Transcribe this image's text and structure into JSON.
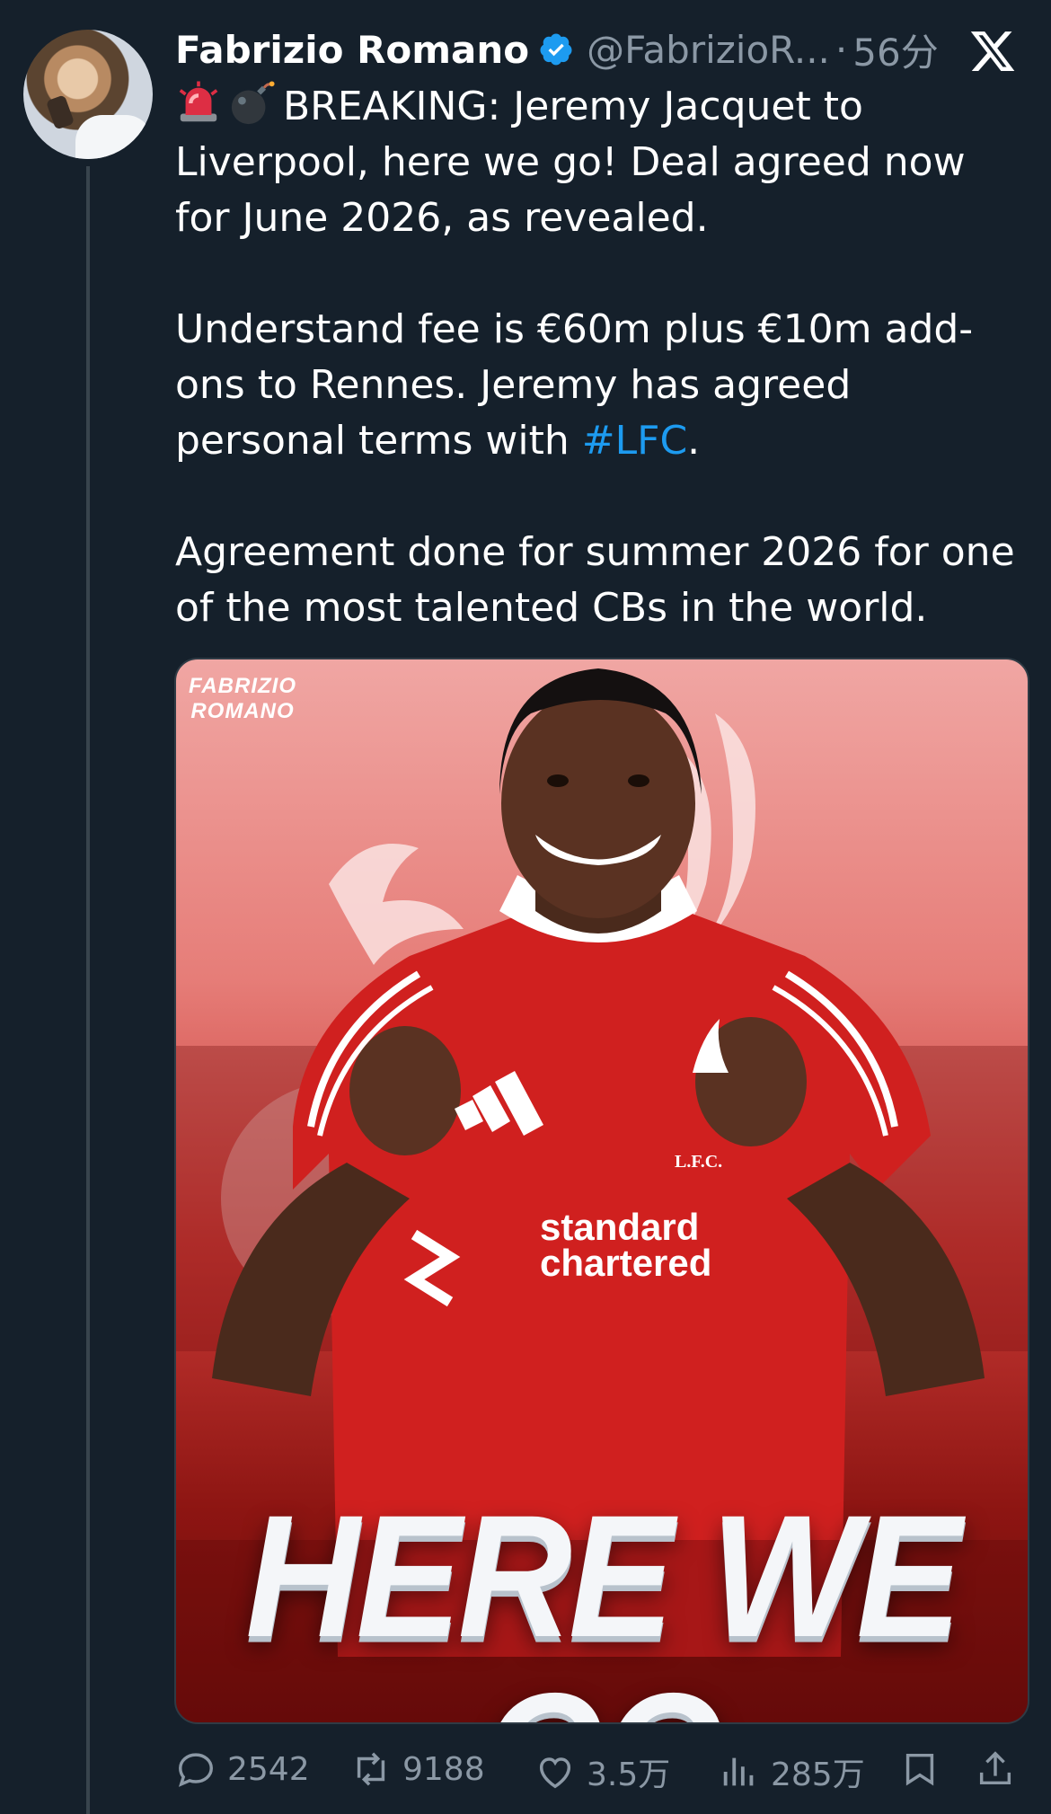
{
  "tweet": {
    "author_name": "Fabrizio Romano",
    "handle": "@FabrizioR...",
    "separator": "·",
    "time": "56分",
    "lines": {
      "p1": "BREAKING: Jeremy Jacquet to Liverpool, here we go! Deal agreed now for June 2026, as revealed.",
      "p2_start": "Understand fee is €60m plus €10m add-ons to Rennes. Jeremy has agreed personal terms with ",
      "hashtag": "#LFC",
      "p2_end": ".",
      "p3": "Agreement done for summer 2026 for one of the most talented CBs in the world."
    },
    "emojis": [
      "rotating-light-icon",
      "bomb-icon"
    ]
  },
  "media": {
    "watermark_line1": "FABRIZIO",
    "watermark_line2": "ROMANO",
    "headline": "HERE WE GO",
    "sponsor_line1": "standard",
    "sponsor_line2": "chartered",
    "crest": "L.F.C."
  },
  "actions": {
    "replies": "2542",
    "retweets": "9188",
    "likes": "3.5万",
    "views": "285万"
  },
  "colors": {
    "background": "#15202b",
    "text": "#ffffff",
    "secondary": "#8b98a5",
    "link": "#1d9bf0",
    "verified": "#1d9bf0"
  }
}
